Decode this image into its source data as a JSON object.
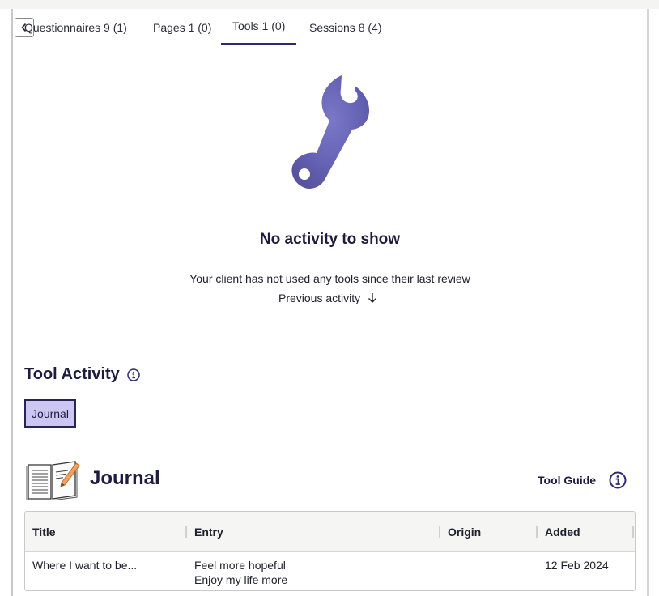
{
  "tabs": [
    {
      "label": "Questionnaires 9 (1)",
      "active": false
    },
    {
      "label": "Pages 1 (0)",
      "active": false
    },
    {
      "label": "Tools 1 (0)",
      "active": true
    },
    {
      "label": "Sessions 8 (4)",
      "active": false
    }
  ],
  "empty_state": {
    "icon": "wrench-icon",
    "title": "No activity to show",
    "description": "Your client has not used any tools since their last review",
    "previous_link": "Previous activity"
  },
  "tool_activity": {
    "title": "Tool Activity",
    "filters": [
      "Journal"
    ]
  },
  "journal": {
    "icon": "journal-book-icon",
    "title": "Journal",
    "tool_guide": "Tool Guide",
    "table": {
      "columns": [
        "Title",
        "Entry",
        "Origin",
        "Added"
      ],
      "rows": [
        {
          "title": "Where I want to be...",
          "entry": [
            "Feel more hopeful",
            "Enjoy my life more"
          ],
          "origin": "",
          "added": "12 Feb 2024"
        }
      ]
    }
  },
  "colors": {
    "accent": "#2c2a72",
    "chip_bg": "#cbc7f2",
    "wrench": "#6a66b8"
  }
}
